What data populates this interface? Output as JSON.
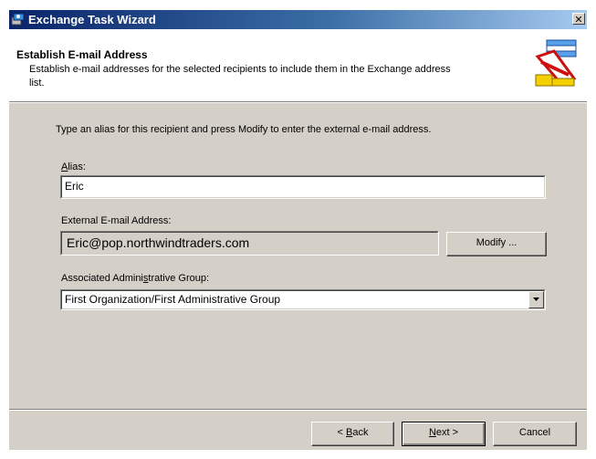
{
  "window": {
    "title": "Exchange Task Wizard",
    "close_symbol": "✕"
  },
  "header": {
    "title": "Establish E-mail Address",
    "description": "Establish e-mail addresses for the selected recipients to include them in the Exchange address list.",
    "icon": "wizard-email-icon"
  },
  "instructions": "Type an alias for this recipient and press Modify to enter the external e-mail address.",
  "alias": {
    "label_accel": "A",
    "label_rest": "lias:",
    "value": "Eric"
  },
  "external_email": {
    "label": "External E-mail Address:",
    "value": "Eric@pop.northwindtraders.com",
    "modify_label": "Modify ..."
  },
  "admin_group": {
    "label_pre": "Associated Admini",
    "label_accel": "s",
    "label_post": "trative Group:",
    "selected": "First Organization/First Administrative Group"
  },
  "buttons": {
    "back_pre": "< ",
    "back_accel": "B",
    "back_post": "ack",
    "next_accel": "N",
    "next_post": "ext >",
    "cancel": "Cancel"
  },
  "colors": {
    "titlebar_start": "#0a246a",
    "titlebar_end": "#a6caf0",
    "dialog_bg": "#d4d0c8"
  }
}
